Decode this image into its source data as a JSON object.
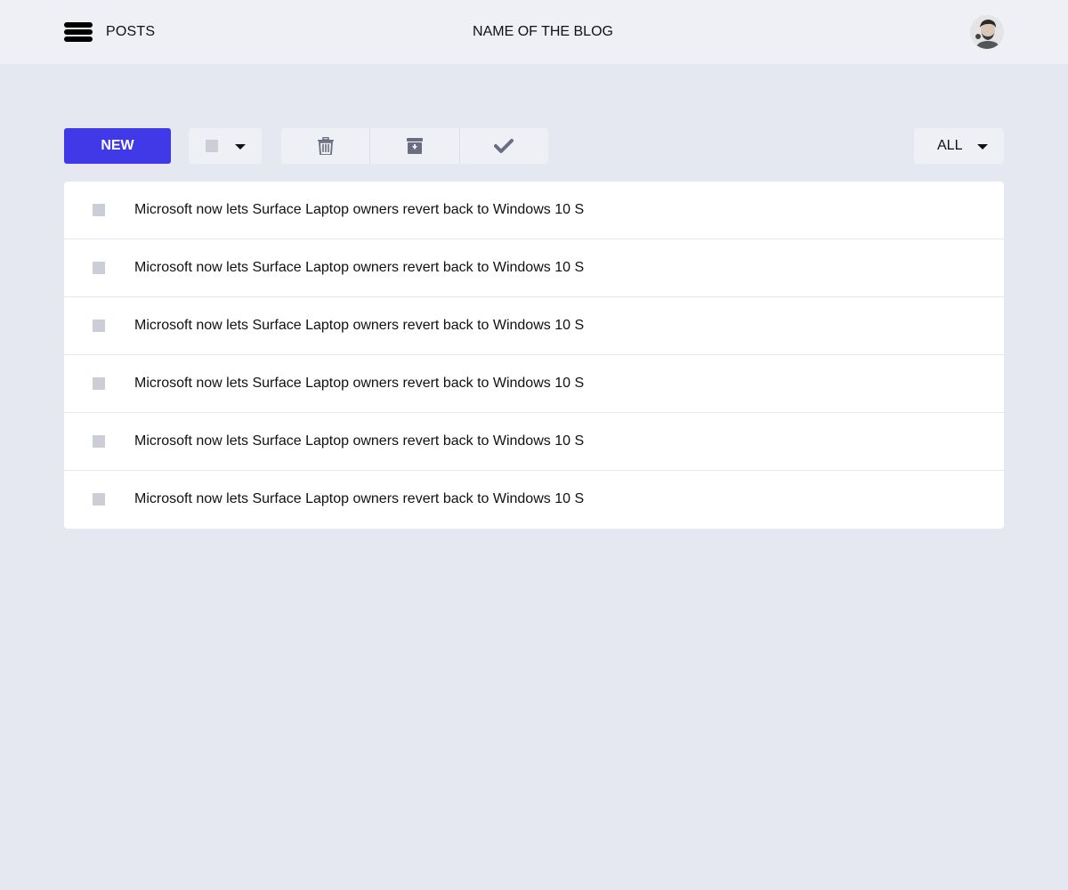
{
  "header": {
    "section_title": "POSTS",
    "blog_name": "NAME OF THE BLOG",
    "avatar_icon": "user-avatar"
  },
  "toolbar": {
    "new_label": "NEW",
    "select_icon": "checkbox-icon",
    "actions": [
      {
        "name": "delete",
        "icon": "trash-icon"
      },
      {
        "name": "archive",
        "icon": "archive-icon"
      },
      {
        "name": "mark-done",
        "icon": "check-icon"
      }
    ],
    "filter_value": "ALL"
  },
  "posts": [
    {
      "title": "Microsoft now lets Surface Laptop owners revert back to Windows 10 S"
    },
    {
      "title": "Microsoft now lets Surface Laptop owners revert back to Windows 10 S"
    },
    {
      "title": "Microsoft now lets Surface Laptop owners revert back to Windows 10 S"
    },
    {
      "title": "Microsoft now lets Surface Laptop owners revert back to Windows 10 S"
    },
    {
      "title": "Microsoft now lets Surface Laptop owners revert back to Windows 10 S"
    },
    {
      "title": "Microsoft now lets Surface Laptop owners revert back to Windows 10 S"
    }
  ],
  "colors": {
    "accent": "#3f39e8",
    "background": "#e5e8f0",
    "topbar": "#eef0f5",
    "checkbox": "#cbcdd7",
    "icon": "#6b6e80"
  }
}
